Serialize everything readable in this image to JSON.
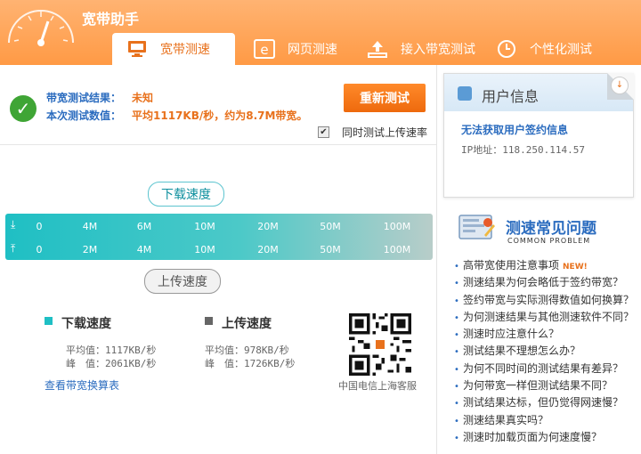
{
  "app": {
    "title": "宽带助手"
  },
  "tabs": [
    {
      "label": "宽带测速",
      "icon": "monitor-icon"
    },
    {
      "label": "网页测速",
      "icon": "browser-icon"
    },
    {
      "label": "接入带宽测试",
      "icon": "upload-tray-icon"
    },
    {
      "label": "个性化测试",
      "icon": "clock-icon"
    }
  ],
  "result": {
    "label1": "带宽测试结果：",
    "value1": "未知",
    "label2": "本次测试数值：",
    "value2": "平均1117KB/秒，约为8.7M带宽。",
    "retest_label": "重新测试",
    "upload_checkbox_label": "同时测试上传速率",
    "upload_checkbox_checked": true
  },
  "meter": {
    "download_label": "下载速度",
    "upload_label": "上传速度",
    "download_ticks": [
      "0",
      "4M",
      "6M",
      "10M",
      "20M",
      "50M",
      "100M"
    ],
    "upload_ticks": [
      "0",
      "2M",
      "4M",
      "10M",
      "20M",
      "50M",
      "100M"
    ]
  },
  "stats": {
    "download": {
      "title": "下载速度",
      "avg": "平均值：1117KB/秒",
      "peak": "峰　值：2061KB/秒",
      "color": "#1fbfc4"
    },
    "upload": {
      "title": "上传速度",
      "avg": "平均值：978KB/秒",
      "peak": "峰　值：1726KB/秒",
      "color": "#666666"
    },
    "link": "查看带宽换算表",
    "qr_caption": "中国电信上海客服"
  },
  "user_info": {
    "title": "用户信息",
    "line1": "无法获取用户签约信息",
    "line2": "IP地址：118.250.114.57"
  },
  "faq": {
    "title": "测速常见问题",
    "subtitle": "COMMON PROBLEM",
    "new_tag": "NEW!",
    "items": [
      "高带宽使用注意事项",
      "测速结果为何会略低于签约带宽？",
      "签约带宽与实际测得数值如何换算？",
      "为何测速结果与其他测速软件不同？",
      "测速时应注意什么？",
      "测试结果不理想怎么办？",
      "为何不同时间的测试结果有差异？",
      "为何带宽一样但测试结果不同？",
      "测试结果达标，但仍觉得网速慢？",
      "测速结果真实吗？",
      "测速时加载页面为何速度慢？"
    ]
  },
  "colors": {
    "brand_orange": "#ff9a45",
    "accent_teal": "#1fbfc4",
    "link_blue": "#2b6cbf",
    "success_green": "#3fa535"
  }
}
